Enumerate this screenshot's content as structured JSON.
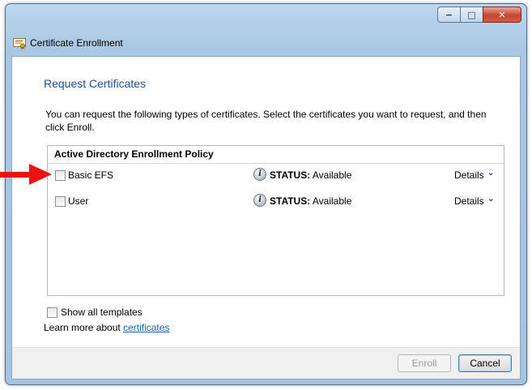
{
  "window": {
    "title": "Certificate Enrollment",
    "controls": {
      "minimize": "−",
      "maximize": "□",
      "close": "✕"
    }
  },
  "page": {
    "heading": "Request Certificates",
    "description": "You can request the following types of certificates. Select the certificates you want to request, and then click Enroll."
  },
  "policy": {
    "header": "Active Directory Enrollment Policy",
    "items": [
      {
        "label": "Basic EFS",
        "status_label": "STATUS:",
        "status_value": "Available",
        "details": "Details",
        "checked": false
      },
      {
        "label": "User",
        "status_label": "STATUS:",
        "status_value": "Available",
        "details": "Details",
        "checked": false
      }
    ]
  },
  "options": {
    "show_all_templates": "Show all templates",
    "learn_more_prefix": "Learn more about",
    "learn_more_link": "certificates"
  },
  "buttons": {
    "enroll": "Enroll",
    "cancel": "Cancel"
  },
  "colors": {
    "heading": "#1e4f94",
    "link": "#1a5fb4",
    "arrow": "#e81414"
  }
}
